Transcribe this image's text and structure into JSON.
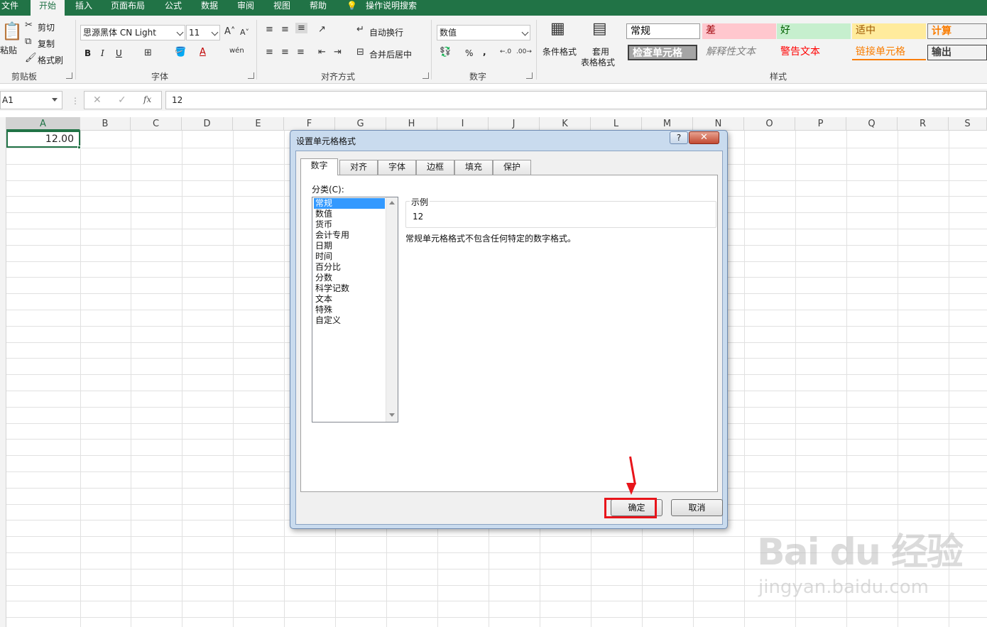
{
  "tabs": [
    "文件",
    "开始",
    "插入",
    "页面布局",
    "公式",
    "数据",
    "审阅",
    "视图",
    "帮助",
    "操作说明搜索"
  ],
  "active_tab": "开始",
  "clipboard": {
    "paste": "粘贴",
    "cut": "剪切",
    "copy": "复制",
    "format_painter": "格式刷",
    "label": "剪贴板"
  },
  "font": {
    "name": "思源黑体 CN Light",
    "size": "11",
    "bold": "B",
    "italic": "I",
    "underline": "U",
    "label": "字体"
  },
  "alignment": {
    "wrap": "自动换行",
    "merge": "合并后居中",
    "label": "对齐方式"
  },
  "number": {
    "format": "数值",
    "label": "数字",
    "percent": "%",
    "comma": ","
  },
  "styles": {
    "conditional": "条件格式",
    "table_fmt_1": "套用",
    "table_fmt_2": "表格格式",
    "items": [
      {
        "label": "常规",
        "bg": "#ffffff",
        "fg": "#000000"
      },
      {
        "label": "差",
        "bg": "#ffc7ce",
        "fg": "#9c0006"
      },
      {
        "label": "好",
        "bg": "#c6efce",
        "fg": "#006100"
      },
      {
        "label": "适中",
        "bg": "#ffeb9c",
        "fg": "#9c5700"
      },
      {
        "label": "计算",
        "bg": "#f2f2f2",
        "fg": "#fa7d00"
      },
      {
        "label": "检查单元格",
        "bg": "#a5a5a5",
        "fg": "#ffffff"
      },
      {
        "label": "解释性文本",
        "bg": "#ffffff",
        "fg": "#7f7f7f"
      },
      {
        "label": "警告文本",
        "bg": "#ffffff",
        "fg": "#ff0000"
      },
      {
        "label": "链接单元格",
        "bg": "#ffffff",
        "fg": "#fa7d00"
      },
      {
        "label": "输出",
        "bg": "#f2f2f2",
        "fg": "#3f3f3f"
      }
    ],
    "label": "样式"
  },
  "formula_bar": {
    "name_box": "A1",
    "formula": "12",
    "fx": "fx"
  },
  "columns": [
    "A",
    "B",
    "C",
    "D",
    "E",
    "F",
    "G",
    "H",
    "I",
    "J",
    "K",
    "L",
    "M",
    "N",
    "O",
    "P",
    "Q",
    "R",
    "S"
  ],
  "active_cell_value": "12.00",
  "dialog": {
    "title": "设置单元格格式",
    "help": "?",
    "close": "✕",
    "tabs": [
      "数字",
      "对齐",
      "字体",
      "边框",
      "填充",
      "保护"
    ],
    "category_label": "分类(C):",
    "categories": [
      "常规",
      "数值",
      "货币",
      "会计专用",
      "日期",
      "时间",
      "百分比",
      "分数",
      "科学记数",
      "文本",
      "特殊",
      "自定义"
    ],
    "selected_category": "常规",
    "sample_label": "示例",
    "sample_value": "12",
    "description": "常规单元格格式不包含任何特定的数字格式。",
    "ok": "确定",
    "cancel": "取消"
  },
  "watermark": {
    "brand": "Bai du 经验",
    "url": "jingyan.baidu.com"
  },
  "colors": {
    "excel_green": "#217346",
    "highlight_red": "#e8151b",
    "selection_blue": "#3399ff"
  }
}
